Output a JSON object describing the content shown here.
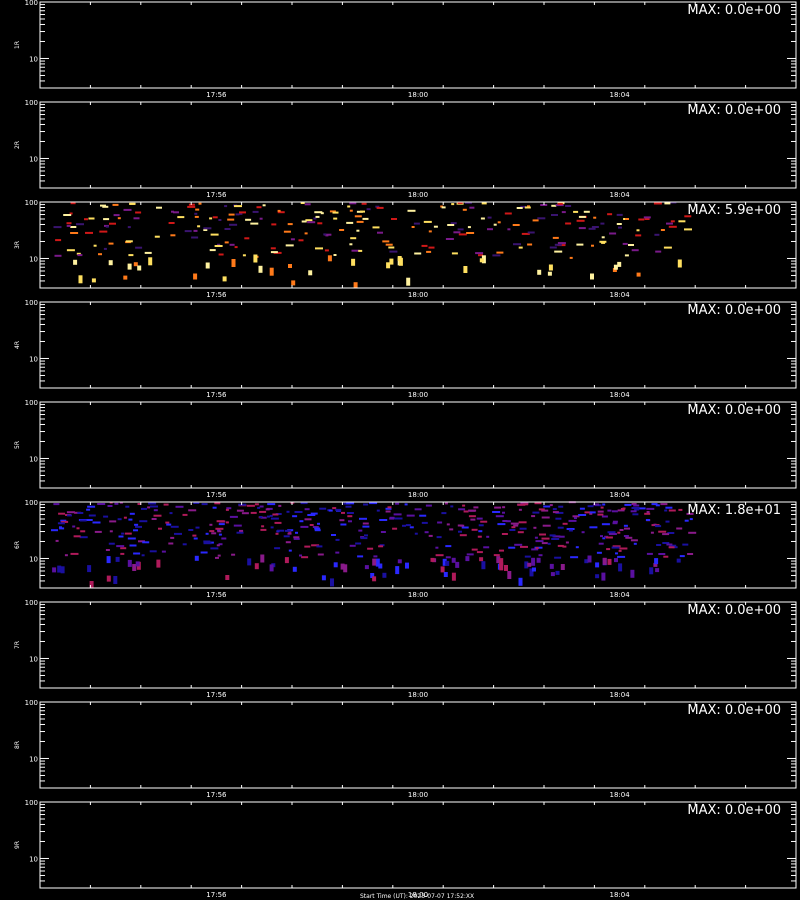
{
  "chart_data": {
    "type": "heatmap",
    "panel_count": 9,
    "y_scale": "log",
    "ylim": [
      3,
      100
    ],
    "y_tick_labels": [
      "100",
      "10"
    ],
    "x_tick_labels": [
      "17:56",
      "18:00",
      "18:04"
    ],
    "x_tick_minutes": [
      3.5,
      7.5,
      11.5
    ],
    "xlim_minutes": [
      0,
      15
    ],
    "data_end_minute": 12.9,
    "panels": [
      {
        "ylabel": "1R",
        "max_label": "MAX: 0.0e+00",
        "max": 0.0,
        "has_data": false
      },
      {
        "ylabel": "2R",
        "max_label": "MAX: 0.0e+00",
        "max": 0.0,
        "has_data": false
      },
      {
        "ylabel": "3R",
        "max_label": "MAX: 5.9e+00",
        "max": 5.9,
        "has_data": true,
        "palette": "warm"
      },
      {
        "ylabel": "4R",
        "max_label": "MAX: 0.0e+00",
        "max": 0.0,
        "has_data": false
      },
      {
        "ylabel": "5R",
        "max_label": "MAX: 0.0e+00",
        "max": 0.0,
        "has_data": false
      },
      {
        "ylabel": "6R",
        "max_label": "MAX: 1.8e+01",
        "max": 18.0,
        "has_data": true,
        "palette": "cool"
      },
      {
        "ylabel": "7R",
        "max_label": "MAX: 0.0e+00",
        "max": 0.0,
        "has_data": false
      },
      {
        "ylabel": "8R",
        "max_label": "MAX: 0.0e+00",
        "max": 0.0,
        "has_data": false
      },
      {
        "ylabel": "9R",
        "max_label": "MAX: 0.0e+00",
        "max": 0.0,
        "has_data": false
      }
    ],
    "footer": "Start Time (UT): 2023-07-07 17:52:XX",
    "colors": {
      "background": "#000000",
      "axes": "#ffffff",
      "warm": [
        "#3a1470",
        "#7a1a8a",
        "#d01818",
        "#ff7a1a",
        "#ffe060",
        "#fff2a0"
      ],
      "cool": [
        "#1a10a0",
        "#2a28ff",
        "#5a10a0",
        "#8a1a8a",
        "#b01a5a"
      ]
    }
  }
}
